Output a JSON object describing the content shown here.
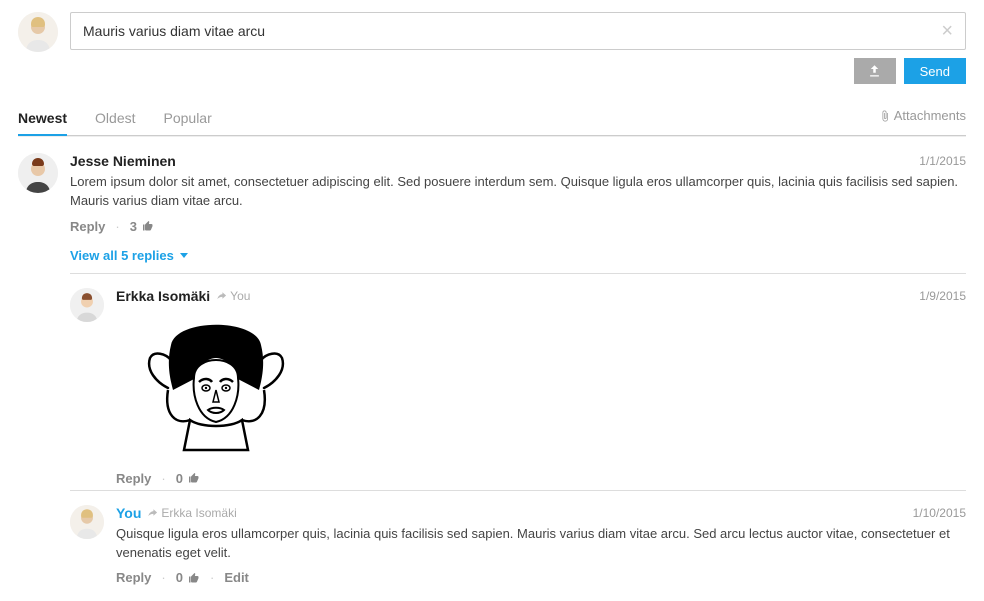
{
  "composer": {
    "value": "Mauris varius diam vitae arcu",
    "send_label": "Send"
  },
  "tabs": {
    "newest": "Newest",
    "oldest": "Oldest",
    "popular": "Popular",
    "attachments": "Attachments"
  },
  "view_all_label": "View all 5 replies",
  "actions": {
    "reply": "Reply",
    "edit": "Edit"
  },
  "comments": [
    {
      "author": "Jesse Nieminen",
      "date": "1/1/2015",
      "text": "Lorem ipsum dolor sit amet, consectetuer adipiscing elit. Sed posuere interdum sem. Quisque ligula eros ullamcorper quis, lacinia quis facilisis sed sapien. Mauris varius diam vitae arcu.",
      "likes": "3"
    }
  ],
  "replies": [
    {
      "author": "Erkka Isomäki",
      "reply_to": "You",
      "date": "1/9/2015",
      "likes": "0"
    },
    {
      "author": "You",
      "reply_to": "Erkka Isomäki",
      "date": "1/10/2015",
      "text": "Quisque ligula eros ullamcorper quis, lacinia quis facilisis sed sapien. Mauris varius diam vitae arcu. Sed arcu lectus auctor vitae, consectetuer et venenatis eget velit.",
      "likes": "0"
    }
  ]
}
